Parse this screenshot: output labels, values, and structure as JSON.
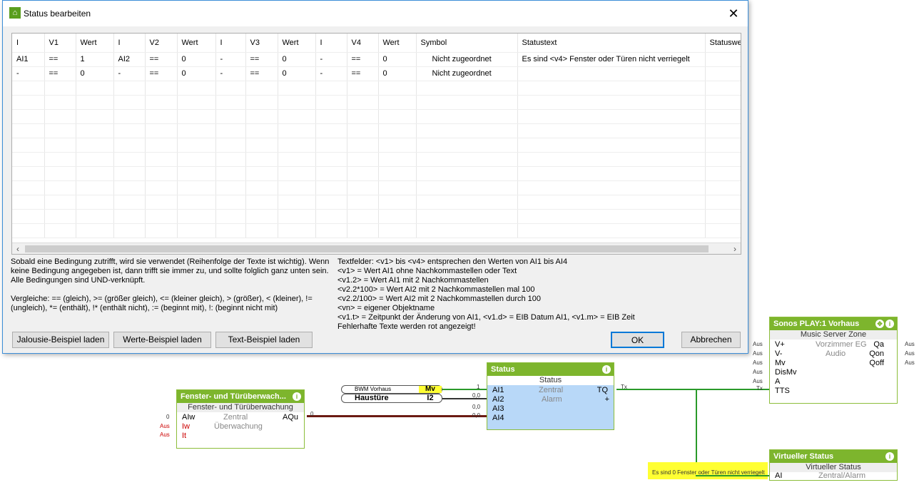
{
  "dialog": {
    "title": "Status bearbeiten",
    "columns": [
      "I",
      "V1",
      "Wert",
      "I",
      "V2",
      "Wert",
      "I",
      "V3",
      "Wert",
      "I",
      "V4",
      "Wert",
      "Symbol",
      "Statustext",
      "Statuswe"
    ],
    "rows": [
      [
        "AI1",
        "==",
        "1",
        "AI2",
        "==",
        "0",
        "-",
        "==",
        "0",
        "-",
        "==",
        "0",
        "Nicht zugeordnet",
        "Es sind <v4> Fenster oder Türen nicht verriegelt",
        ""
      ],
      [
        "-",
        "==",
        "0",
        "-",
        "==",
        "0",
        "-",
        "==",
        "0",
        "-",
        "==",
        "0",
        "Nicht zugeordnet",
        "",
        ""
      ]
    ],
    "help_left": "Sobald eine Bedingung zutrifft, wird sie verwendet (Reihenfolge der Texte ist wichtig). Wenn\nkeine Bedingung angegeben ist, dann trifft sie immer zu, und sollte folglich ganz unten sein.\nAlle Bedingungen sind UND-verknüpft.\n\nVergleiche: == (gleich), >= (größer gleich), <= (kleiner gleich), > (größer), < (kleiner), !=\n(ungleich), *= (enthält), !* (enthält nicht), := (beginnt mit), !: (beginnt nicht mit)",
    "help_right": "Textfelder: <v1> bis <v4> entsprechen den Werten von AI1 bis AI4\n<v1> = Wert AI1 ohne Nachkommastellen oder Text\n<v1.2> = Wert AI1 mit 2 Nachkommastellen\n<v2.2*100> = Wert AI2 mit 2 Nachkommastellen mal 100\n<v2.2/100> = Wert AI2 mit 2 Nachkommastellen durch 100\n<vn> = eigener Objektname\n<v1.t> = Zeitpunkt der Änderung von AI1, <v1.d> = EIB Datum AI1, <v1.m> = EIB Zeit\nFehlerhafte Texte werden rot angezeigt!",
    "buttons": {
      "jalousie": "Jalousie-Beispiel laden",
      "werte": "Werte-Beispiel laden",
      "text": "Text-Beispiel laden",
      "ok": "OK",
      "cancel": "Abbrechen"
    }
  },
  "canvas": {
    "fenster": {
      "title": "Fenster- und Türüberwach...",
      "sub": "Fenster- und Türüberwachung",
      "in": [
        "AIw",
        "Iw",
        "It"
      ],
      "in_vals": [
        "0",
        "Aus",
        "Aus"
      ],
      "mid": [
        "Zentral",
        "Überwachung"
      ],
      "out": "AQu",
      "out_val": "0"
    },
    "inputs": [
      {
        "name": "BWM Vorhaus",
        "tag": "Mv"
      },
      {
        "name": "Haustüre",
        "tag": "I2"
      }
    ],
    "status": {
      "title": "Status",
      "sub": "Status",
      "in": [
        "AI1",
        "AI2",
        "AI3",
        "AI4"
      ],
      "in_vals": [
        "1",
        "0,0",
        "0,0",
        "0,0"
      ],
      "mid": [
        "Zentral",
        "Alarm"
      ],
      "out": "TQ",
      "out_val": "Tx",
      "plus": "+"
    },
    "sonos": {
      "title": "Sonos PLAY:1 Vorhaus",
      "sub": "Music Server Zone",
      "in": [
        "V+",
        "V-",
        "Mv",
        "DisMv",
        "A",
        "TTS"
      ],
      "in_vals": [
        "Aus",
        "Aus",
        "Aus",
        "Aus",
        "Aus",
        "Tx"
      ],
      "mid": [
        "Vorzimmer EG",
        "Audio"
      ],
      "out": [
        "Qa",
        "Qon",
        "Qoff"
      ],
      "out_vals": [
        "Aus",
        "Aus",
        "Aus"
      ]
    },
    "virtuell": {
      "title": "Virtueller Status",
      "sub": "Virtueller Status",
      "in": "AI",
      "mid": "Zentral/Alarm",
      "value": "Es sind 0 Fenster oder Türen nicht verriegelt"
    }
  }
}
